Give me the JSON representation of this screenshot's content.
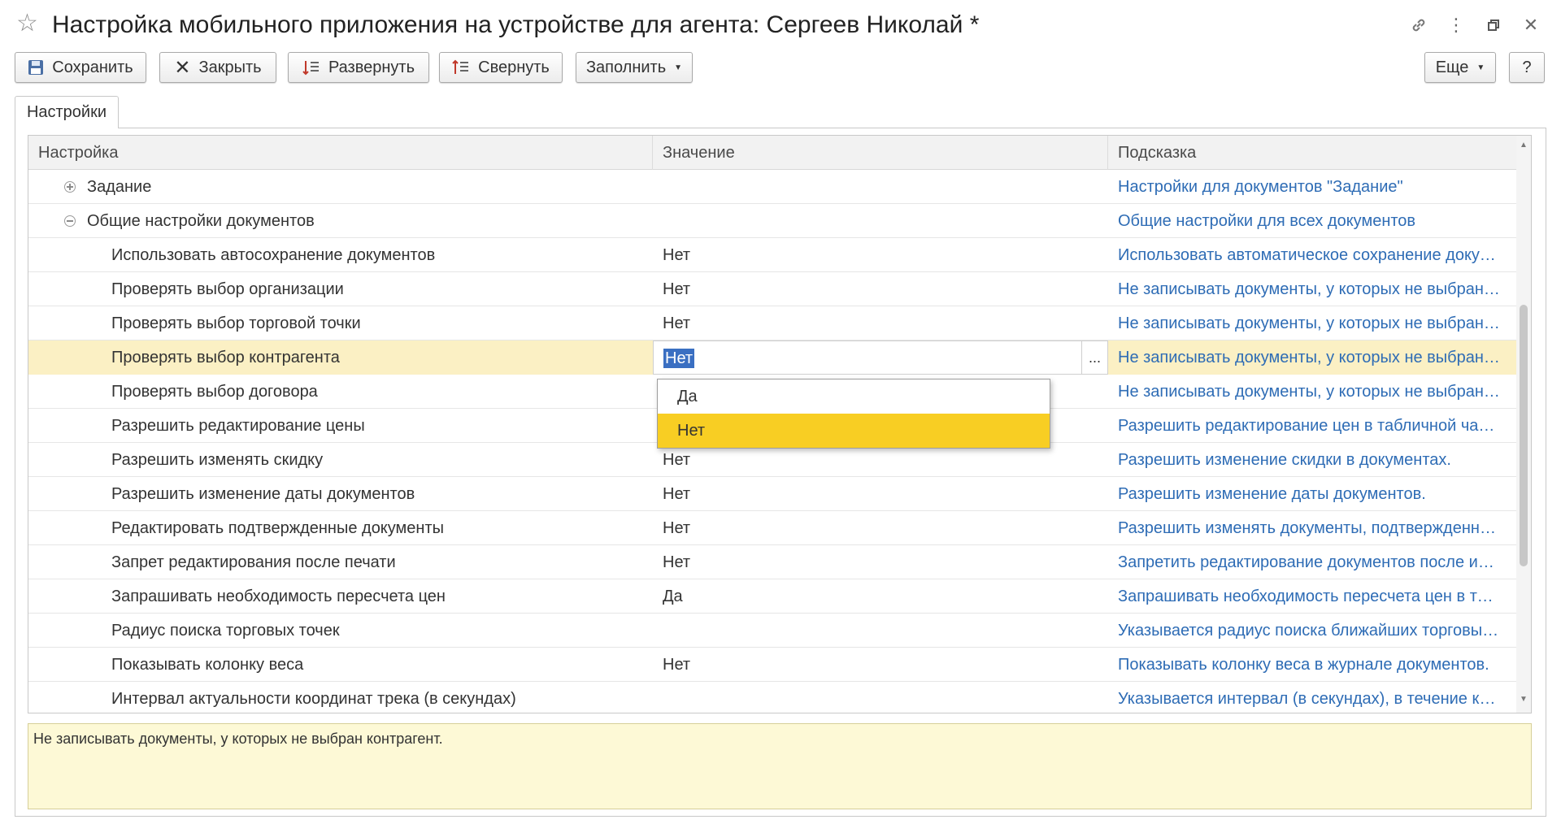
{
  "window": {
    "title": "Настройка мобильного приложения на устройстве для агента: Сергеев Николай *"
  },
  "toolbar": {
    "save_label": "Сохранить",
    "close_label": "Закрыть",
    "expand_label": "Развернуть",
    "collapse_label": "Свернуть",
    "fill_label": "Заполнить",
    "more_label": "Еще",
    "help_label": "?"
  },
  "tabs": [
    {
      "label": "Настройки"
    }
  ],
  "grid": {
    "columns": [
      "Настройка",
      "Значение",
      "Подсказка"
    ],
    "rows": [
      {
        "setting": "Задание",
        "value": "",
        "hint": "Настройки для документов \"Задание\""
      },
      {
        "setting": "Общие настройки документов",
        "value": "",
        "hint": "Общие настройки для всех документов"
      },
      {
        "setting": "Использовать автосохранение документов",
        "value": "Нет",
        "hint": "Использовать автоматическое сохранение документов"
      },
      {
        "setting": "Проверять выбор организации",
        "value": "Нет",
        "hint": "Не записывать документы, у которых не выбрана организация"
      },
      {
        "setting": "Проверять выбор торговой точки",
        "value": "Нет",
        "hint": "Не записывать документы, у которых не выбрана торговая точка"
      },
      {
        "setting": "Проверять выбор контрагента",
        "value": "Нет",
        "hint": "Не записывать документы, у которых не выбран контрагент"
      },
      {
        "setting": "Проверять выбор договора",
        "value": "",
        "hint": "Не записывать документы, у которых не выбран договор"
      },
      {
        "setting": "Разрешить редактирование цены",
        "value": "",
        "hint": "Разрешить редактирование цен в табличной части"
      },
      {
        "setting": "Разрешить изменять скидку",
        "value": "Нет",
        "hint": "Разрешить изменение скидки в документах."
      },
      {
        "setting": "Разрешить изменение даты документов",
        "value": "Нет",
        "hint": "Разрешить изменение даты документов."
      },
      {
        "setting": "Редактировать подтвержденные документы",
        "value": "Нет",
        "hint": "Разрешить изменять документы, подтвержденные"
      },
      {
        "setting": "Запрет редактирования после печати",
        "value": "Нет",
        "hint": "Запретить редактирование документов после их печати"
      },
      {
        "setting": "Запрашивать необходимость пересчета цен",
        "value": "Да",
        "hint": "Запрашивать необходимость пересчета цен в табличной части"
      },
      {
        "setting": "Радиус поиска торговых точек",
        "value": "",
        "hint": "Указывается радиус поиска ближайших торговых точек"
      },
      {
        "setting": "Показывать колонку веса",
        "value": "Нет",
        "hint": "Показывать колонку веса в журнале документов."
      },
      {
        "setting": "Интервал актуальности координат трека (в секундах)",
        "value": "",
        "hint": "Указывается интервал (в секундах), в течение которого"
      }
    ]
  },
  "editor": {
    "current_value": "Нет",
    "dots": "...",
    "options": [
      "Да",
      "Нет"
    ],
    "highlighted_option": "Нет"
  },
  "hint_panel": {
    "text": "Не записывать документы, у которых не выбран контрагент."
  }
}
